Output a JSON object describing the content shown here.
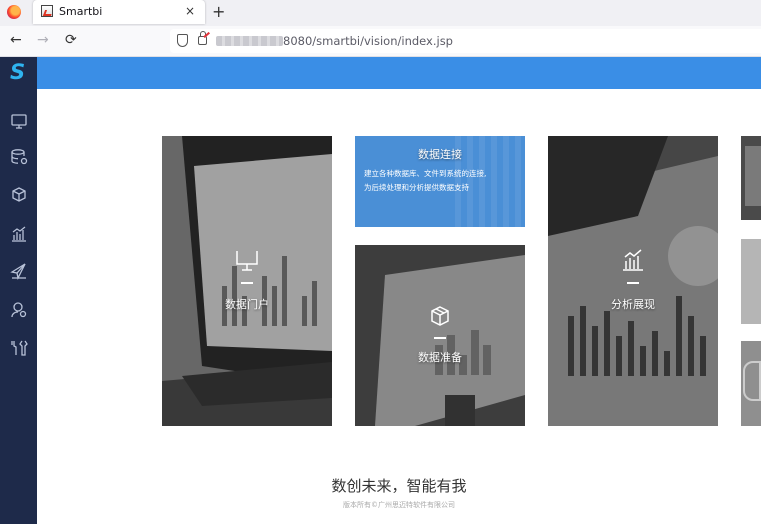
{
  "browser": {
    "tab_title": "Smartbi",
    "tab_close": "×",
    "new_tab": "+",
    "back": "←",
    "forward": "→",
    "reload": "⟳",
    "url_visible": "8080/smartbi/vision/index.jsp"
  },
  "app": {
    "logo": "S",
    "header_color": "#3a8ee6",
    "sidebar_color": "#1e2a4a",
    "sidebar": [
      {
        "icon": "monitor-icon"
      },
      {
        "icon": "database-icon"
      },
      {
        "icon": "cube-icon"
      },
      {
        "icon": "bar-chart-icon"
      },
      {
        "icon": "send-icon"
      },
      {
        "icon": "user-settings-icon"
      },
      {
        "icon": "tools-icon"
      }
    ]
  },
  "tiles": {
    "portal": {
      "label": "数据门户",
      "icon": "monitor-icon"
    },
    "connect": {
      "title": "数据连接",
      "desc_line1": "建立各种数据库、文件到系统的连接,",
      "desc_line2": "为后续处理和分析提供数据支持"
    },
    "prepare": {
      "label": "数据准备",
      "icon": "cube-icon"
    },
    "analysis": {
      "label": "分析展现",
      "icon": "bar-chart-icon"
    }
  },
  "footer": {
    "slogan": "数创未来，智能有我",
    "copyright": "版本所有©广州思迈特软件有限公司"
  }
}
